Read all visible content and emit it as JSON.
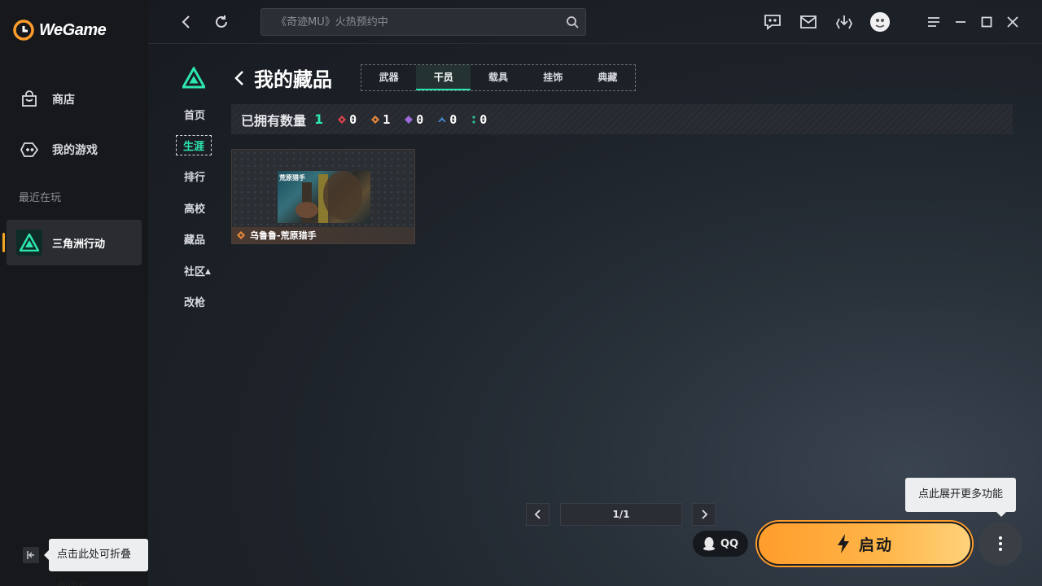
{
  "app": {
    "name": "WeGame"
  },
  "sidebar": {
    "items": [
      {
        "label": "商店",
        "icon": "shopping-bag-icon"
      },
      {
        "label": "我的游戏",
        "icon": "gamepad-icon"
      }
    ],
    "recent_label": "最近在玩",
    "recent_games": [
      {
        "name": "三角洲行动",
        "icon": "delta-force-icon"
      }
    ],
    "collapse_tip": "点击此处可折叠侧边栏"
  },
  "topbar": {
    "search_placeholder": "《奇迹MU》火热预约中",
    "icons": [
      "back-icon",
      "refresh-icon",
      "search-icon",
      "chat-icon",
      "mail-icon",
      "download-icon",
      "avatar",
      "menu-icon",
      "minimize-icon",
      "maximize-icon",
      "close-icon"
    ]
  },
  "game_nav": {
    "items": [
      "首页",
      "生涯",
      "排行",
      "高校",
      "藏品",
      "社区",
      "改枪"
    ],
    "active": "生涯"
  },
  "collection": {
    "title": "我的藏品",
    "tabs": [
      "武器",
      "干员",
      "载具",
      "挂饰",
      "典藏"
    ],
    "active_tab": "干员",
    "owned_label": "已拥有数量",
    "owned_total": "1",
    "rarity_counts": [
      {
        "color": "#e0434b",
        "count": "0"
      },
      {
        "color": "#e8893a",
        "count": "1"
      },
      {
        "color": "#9b6ad8",
        "count": "0"
      },
      {
        "color": "#4a8ed8",
        "count": "0"
      },
      {
        "color": "#2ec49a",
        "count": "0"
      }
    ],
    "cards": [
      {
        "name": "乌鲁鲁-荒原猎手",
        "image_label": "荒原猎手",
        "rarity_color": "#e8893a"
      }
    ],
    "pagination": {
      "text": "1/1"
    }
  },
  "actions": {
    "qq_label": "QQ",
    "launch_label": "启动",
    "more_tip": "点此展开更多功能"
  },
  "colors": {
    "accent": "#2ee6b0",
    "launch": "#ffa83a"
  }
}
